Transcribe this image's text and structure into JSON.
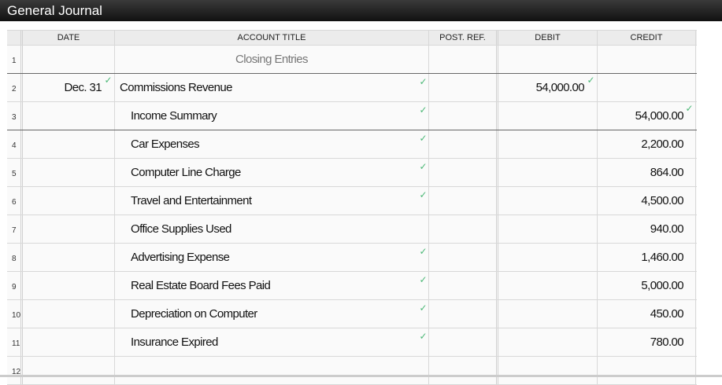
{
  "title": "General Journal",
  "headers": {
    "date": "DATE",
    "account": "ACCOUNT TITLE",
    "post_ref": "POST. REF.",
    "debit": "DEBIT",
    "credit": "CREDIT"
  },
  "check_icon": "✓",
  "rows": [
    {
      "n": "1",
      "date": "",
      "account": "Closing Entries",
      "debit": "",
      "credit": ""
    },
    {
      "n": "2",
      "date": "Dec. 31",
      "account": "Commissions Revenue",
      "debit": "54,000.00",
      "credit": ""
    },
    {
      "n": "3",
      "date": "",
      "account": "Income Summary",
      "debit": "",
      "credit": "54,000.00"
    },
    {
      "n": "4",
      "date": "",
      "account": "Car Expenses",
      "debit": "",
      "credit": "2,200.00"
    },
    {
      "n": "5",
      "date": "",
      "account": "Computer Line Charge",
      "debit": "",
      "credit": "864.00"
    },
    {
      "n": "6",
      "date": "",
      "account": "Travel and Entertainment",
      "debit": "",
      "credit": "4,500.00"
    },
    {
      "n": "7",
      "date": "",
      "account": "Office Supplies Used",
      "debit": "",
      "credit": "940.00"
    },
    {
      "n": "8",
      "date": "",
      "account": "Advertising Expense",
      "debit": "",
      "credit": "1,460.00"
    },
    {
      "n": "9",
      "date": "",
      "account": "Real Estate Board Fees Paid",
      "debit": "",
      "credit": "5,000.00"
    },
    {
      "n": "10",
      "date": "",
      "account": "Depreciation on Computer",
      "debit": "",
      "credit": "450.00"
    },
    {
      "n": "11",
      "date": "",
      "account": "Insurance Expired",
      "debit": "",
      "credit": "780.00"
    },
    {
      "n": "12",
      "date": "",
      "account": "",
      "debit": "",
      "credit": ""
    }
  ]
}
